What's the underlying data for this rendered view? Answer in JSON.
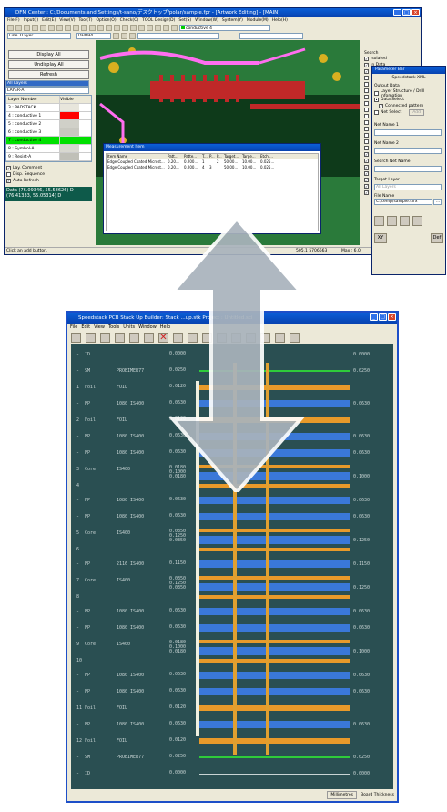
{
  "dfm": {
    "title": "DFM Center : C:/Documents and Settings/t-sano/デスクトップ/polar/sample.fpr - [Artwork Editing] - [MAIN]",
    "menu": [
      "File(F)",
      "Input(I)",
      "Edit(E)",
      "View(V)",
      "Tool(T)",
      "Option(O)",
      "Check(C)",
      "TOOL Design(D)",
      "Set(S)",
      "Window(W)",
      "System(Y)",
      "Module(M)",
      "Help(H)"
    ],
    "layer_box": "Line 7Layer",
    "cell_box": "DEMB4",
    "layer_select": "conductive 4",
    "buttons": [
      "Display All",
      "Undisplay All",
      "Refresh"
    ],
    "all_layers": "All Layers",
    "layer_a": "LAYER-A",
    "table_headers": [
      "Layer Number",
      "Visible"
    ],
    "layers": [
      {
        "name": "3 : PADSTACK",
        "color": "#e8e6dc"
      },
      {
        "name": "4 : conductive 1",
        "color": "#ff0000"
      },
      {
        "name": "5 : conductive 2",
        "color": "#d0d0c8"
      },
      {
        "name": "6 : conductive 3",
        "color": "#c8c8c0"
      },
      {
        "name": "7 : conductive 4",
        "color": "#00e000"
      },
      {
        "name": "8 : Symbol-A",
        "color": "#d8d8d0"
      },
      {
        "name": "9 : Resist-A",
        "color": "#c0c0b8"
      }
    ],
    "checks": [
      "Lay. Comment",
      "Disp. Sequence",
      "Auto Refresh"
    ],
    "data_line1": "Data (76.09346, 55.58626) D",
    "data_line2": "(76.41333, 55.05314) D",
    "status": "Click an add button.",
    "status_right": "505.1 5706663",
    "status_max": "Max : 6.0"
  },
  "measure": {
    "title": "Measurement Item",
    "headers": [
      "Item Name",
      "Patt...",
      "Patte...",
      "T...",
      "P...",
      "P...",
      "Target...",
      "Targe...",
      "Etch ..."
    ],
    "rows": [
      [
        "Edge Coupled Coated Microst...",
        "0.20...",
        "0.200...",
        "1",
        "",
        "2",
        "50.00...",
        "10.00...",
        "0.025..."
      ],
      [
        "Edge Coupled Coated Microst...",
        "0.20...",
        "0.200...",
        "4",
        "3",
        "",
        "50.00...",
        "10.00...",
        "0.025..."
      ]
    ]
  },
  "side": {
    "search": "Search",
    "items": [
      "Isolated",
      "In Data",
      "In Comp",
      "Act.",
      "Ref.",
      "Same Point",
      "Options for S",
      "Cross",
      "Ref.",
      "Pass",
      "Wide Width",
      "Pattern Leng",
      "Screening Dim",
      "Noun",
      "Cond",
      "Land",
      "Line",
      "Surface",
      "Plane/plane",
      "Hatching",
      "Text",
      "Symbol"
    ]
  },
  "param": {
    "title": "Parameter Bar",
    "sub": "Speedstack-XML",
    "output": "Output Data",
    "opt1": "Layer Structure / Drill Infomation",
    "opt2": "Data Select",
    "opt3": "Connected pattern",
    "opt4": "Net Select",
    "add": "Add",
    "net1": "Net Name 1",
    "net2": "Net Name 2",
    "search_net": "Search Net Name",
    "target": "Target Layer",
    "target_val": "All Layers",
    "file": "File Name",
    "file_val": "C:/temp/sample.sfrx",
    "def": "Def"
  },
  "stack": {
    "title": "Speedstack PCB Stack Up Builder:  Stack  ...up.stk  Project : Untitled.sci",
    "menu": [
      "File",
      "Edit",
      "View",
      "Tools",
      "Units",
      "Window",
      "Help"
    ],
    "status_units": "Millimetres",
    "status_board": "Board Thickness",
    "rows": [
      {
        "a": "-",
        "b": "ID",
        "d": "",
        "v": [
          "0.0000"
        ],
        "r": "0.0000",
        "type": "id"
      },
      {
        "a": "-",
        "b": "SM",
        "d": "PROBIMER77",
        "v": [
          "0.0250"
        ],
        "r": "0.0250",
        "type": "sm"
      },
      {
        "a": "1",
        "b": "Foil",
        "d": "FOIL",
        "v": [
          "0.0120"
        ],
        "r": "",
        "type": "foil"
      },
      {
        "a": "-",
        "b": "PP",
        "d": "1080 IS400",
        "v": [
          "0.0630"
        ],
        "r": "0.0630",
        "type": "pp"
      },
      {
        "a": "2",
        "b": "Foil",
        "d": "FOIL",
        "v": [
          "0.0120"
        ],
        "r": "",
        "type": "foil"
      },
      {
        "a": "-",
        "b": "PP",
        "d": "1080 IS400",
        "v": [
          "0.0630"
        ],
        "r": "0.0630",
        "type": "pp"
      },
      {
        "a": "-",
        "b": "PP",
        "d": "1080 IS400",
        "v": [
          "0.0630"
        ],
        "r": "0.0630",
        "type": "pp"
      },
      {
        "a": "3",
        "b": "Core",
        "d": "IS400",
        "v": [
          "0.0180",
          "0.1000",
          "0.0180"
        ],
        "r": "0.1000",
        "type": "core"
      },
      {
        "a": "-",
        "b": "PP",
        "d": "1080 IS400",
        "v": [
          "0.0630"
        ],
        "r": "0.0630",
        "type": "pp"
      },
      {
        "a": "-",
        "b": "PP",
        "d": "1080 IS400",
        "v": [
          "0.0630"
        ],
        "r": "0.0630",
        "type": "pp"
      },
      {
        "a": "5",
        "b": "Core",
        "d": "IS400",
        "v": [
          "0.0350",
          "0.1250",
          "0.0350"
        ],
        "r": "0.1250",
        "type": "core"
      },
      {
        "a": "-",
        "b": "PP",
        "d": "2116 IS400",
        "v": [
          "0.1150"
        ],
        "r": "0.1150",
        "type": "pp"
      },
      {
        "a": "7",
        "b": "Core",
        "d": "IS400",
        "v": [
          "0.0350",
          "0.1250",
          "0.0350"
        ],
        "r": "0.1250",
        "type": "core"
      },
      {
        "a": "-",
        "b": "PP",
        "d": "1080 IS400",
        "v": [
          "0.0630"
        ],
        "r": "0.0630",
        "type": "pp"
      },
      {
        "a": "-",
        "b": "PP",
        "d": "1080 IS400",
        "v": [
          "0.0630"
        ],
        "r": "0.0630",
        "type": "pp"
      },
      {
        "a": "9",
        "b": "Core",
        "d": "IS400",
        "v": [
          "0.0180",
          "0.1000",
          "0.0180"
        ],
        "r": "0.1000",
        "type": "core"
      },
      {
        "a": "-",
        "b": "PP",
        "d": "1080 IS400",
        "v": [
          "0.0630"
        ],
        "r": "0.0630",
        "type": "pp"
      },
      {
        "a": "-",
        "b": "PP",
        "d": "1080 IS400",
        "v": [
          "0.0630"
        ],
        "r": "0.0630",
        "type": "pp"
      },
      {
        "a": "11",
        "b": "Foil",
        "d": "FOIL",
        "v": [
          "0.0120"
        ],
        "r": "",
        "type": "foil"
      },
      {
        "a": "-",
        "b": "PP",
        "d": "1080 IS400",
        "v": [
          "0.0630"
        ],
        "r": "0.0630",
        "type": "pp"
      },
      {
        "a": "12",
        "b": "Foil",
        "d": "FOIL",
        "v": [
          "0.0120"
        ],
        "r": "",
        "type": "foil"
      },
      {
        "a": "-",
        "b": "SM",
        "d": "PROBIMER77",
        "v": [
          "0.0250"
        ],
        "r": "0.0250",
        "type": "sm"
      },
      {
        "a": "-",
        "b": "ID",
        "d": "",
        "v": [
          "0.0000"
        ],
        "r": "0.0000",
        "type": "id"
      }
    ],
    "core_subnums": {
      "3": "4",
      "5": "6",
      "7": "8",
      "9": "10"
    }
  },
  "colors": {
    "pp": "#3a78d8",
    "foil": "#e89a2a",
    "sm": "#2ecc3a",
    "arrow": "#9aa6b0",
    "drill": "#e0a030"
  }
}
